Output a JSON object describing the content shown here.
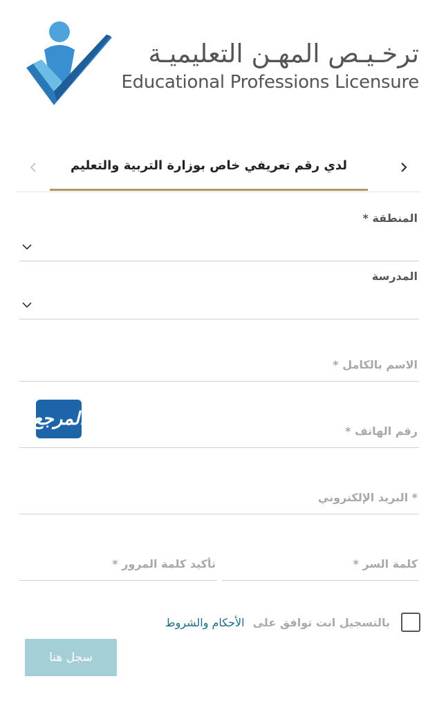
{
  "header": {
    "title_ar": "ترخـيـص المهـن التعليميـة",
    "title_en": "Educational Professions Licensure"
  },
  "tabs": {
    "active_label": "لدي رقم تعريفي خاص بوزارة التربية والتعليم"
  },
  "form": {
    "region_label": "المنطقة *",
    "school_label": "المدرسة",
    "fullname_placeholder": "الاسم بالكامل *",
    "phone_placeholder": "رقم الهاتف *",
    "email_placeholder": "* البريد الإلكتروني",
    "password_placeholder": "كلمة السر *",
    "confirm_password_placeholder": "تأكيد كلمة المرور *"
  },
  "watermark": {
    "text": "المرجع"
  },
  "terms": {
    "text": "بالتسجيل انت توافق على",
    "link": "الأحكام والشروط"
  },
  "submit_label": "سجل هنا",
  "colors": {
    "accent_underline": "#b09a6b",
    "button_bg": "#a4cfd6",
    "link": "#1d6a83",
    "logo_blue": "#3a8fd0"
  },
  "icons": {
    "tab_prev": "chevron-right-icon",
    "tab_next": "chevron-left-icon",
    "select_caret": "chevron-down-icon"
  }
}
